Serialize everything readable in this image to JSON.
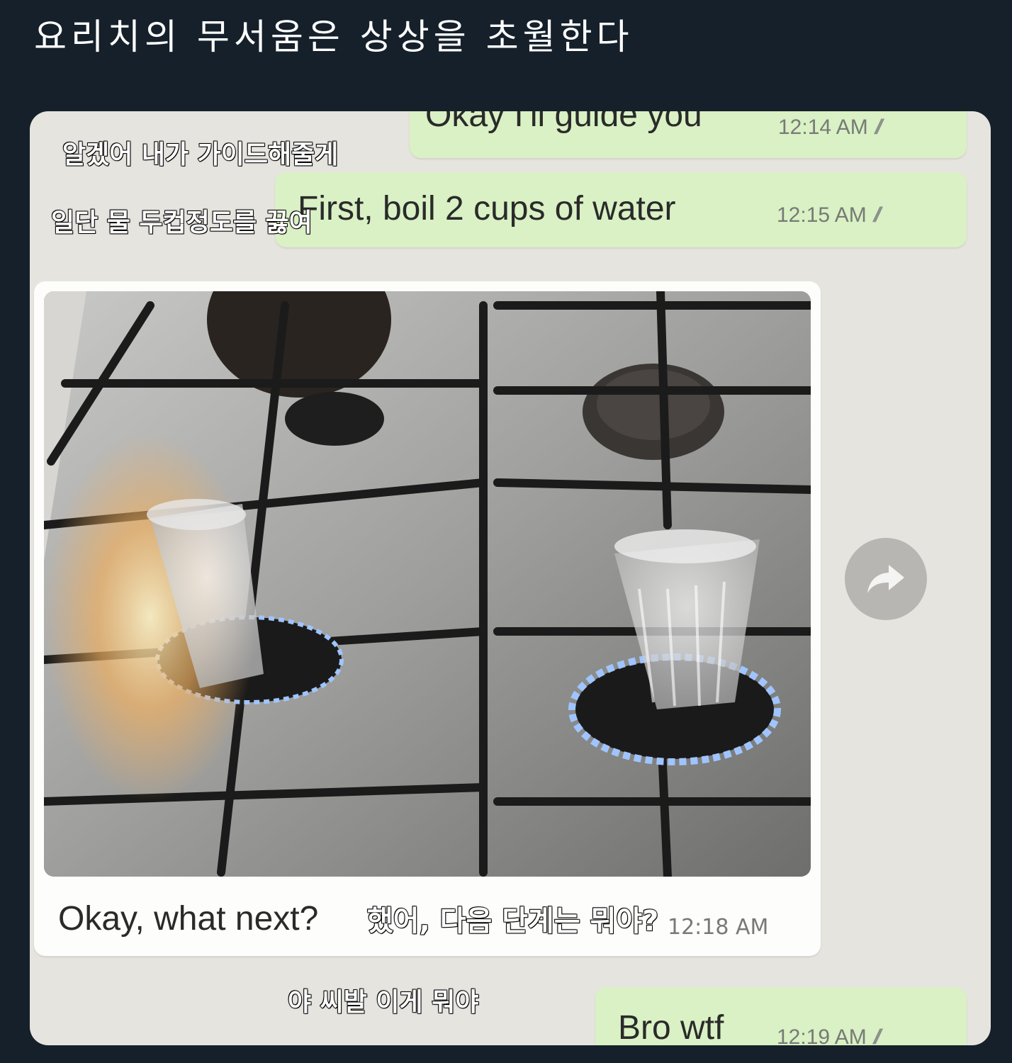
{
  "post": {
    "title": "요리치의 무서움은 상상을 초월한다"
  },
  "chat": {
    "messages": [
      {
        "direction": "outgoing",
        "text": "Okay I'll guide you",
        "time": "12:14 AM",
        "status": "read-double-check",
        "korean_caption": "알겠어 내가 가이드해줄게"
      },
      {
        "direction": "outgoing",
        "text": "First, boil 2 cups of water",
        "time": "12:15 AM",
        "status": "read-double-check",
        "korean_caption": "일단 물 두컵정도를 끓여"
      },
      {
        "direction": "incoming",
        "type": "photo",
        "text": "Okay, what next?",
        "time": "12:18 AM",
        "korean_caption": "했어, 다음 단계는 뭐야?"
      },
      {
        "direction": "outgoing",
        "text": "Bro wtf",
        "time": "12:19 AM",
        "status": "read-double-check",
        "korean_caption": "야 씨발 이게 뭐야"
      }
    ],
    "forward_icon": "forward-arrow-icon",
    "tick_glyph": "//"
  },
  "colors": {
    "page_bg": "#15202b",
    "chat_bg": "#e6e4de",
    "outgoing_bubble": "#d9f1c4",
    "incoming_bubble": "#fdfdfb",
    "flame_blue": "#9fc4ff"
  }
}
